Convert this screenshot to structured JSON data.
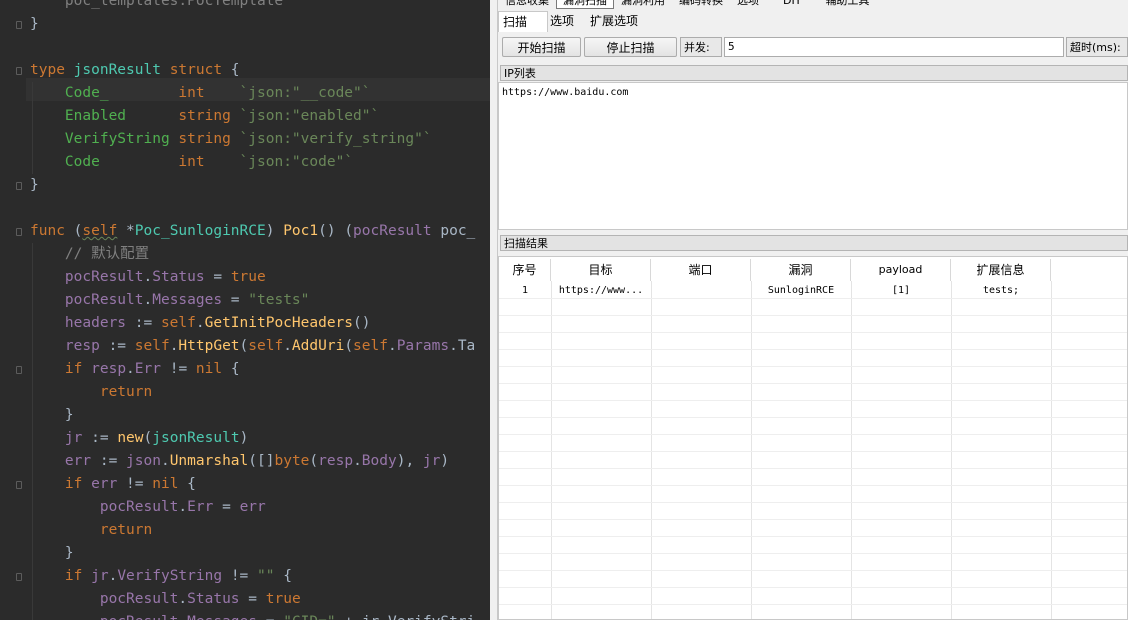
{
  "editor": {
    "lines": [
      [
        [
          "    ",
          ""
        ],
        [
          "poc_templates.PocTemplate",
          "cmt"
        ]
      ],
      [
        [
          "}",
          ""
        ]
      ],
      [
        [
          "",
          ""
        ]
      ],
      [
        [
          "type ",
          "kw"
        ],
        [
          "jsonResult ",
          "type"
        ],
        [
          "struct ",
          "kw"
        ],
        [
          "{",
          ""
        ]
      ],
      [
        [
          "    ",
          ""
        ],
        [
          "Code_",
          "gfld"
        ],
        [
          "        ",
          ""
        ],
        [
          "int",
          "kw"
        ],
        [
          "    ",
          ""
        ],
        [
          "`json:\"__code\"`",
          "tag"
        ]
      ],
      [
        [
          "    ",
          ""
        ],
        [
          "Enabled",
          "gfld"
        ],
        [
          "      ",
          ""
        ],
        [
          "string",
          "kw"
        ],
        [
          " ",
          ""
        ],
        [
          "`json:\"enabled\"`",
          "tag"
        ]
      ],
      [
        [
          "    ",
          ""
        ],
        [
          "VerifyString",
          "gfld"
        ],
        [
          " ",
          ""
        ],
        [
          "string",
          "kw"
        ],
        [
          " ",
          ""
        ],
        [
          "`json:\"verify_string\"`",
          "tag"
        ]
      ],
      [
        [
          "    ",
          ""
        ],
        [
          "Code",
          "gfld"
        ],
        [
          "         ",
          ""
        ],
        [
          "int",
          "kw"
        ],
        [
          "    ",
          ""
        ],
        [
          "`json:\"code\"`",
          "tag"
        ]
      ],
      [
        [
          "}",
          ""
        ]
      ],
      [
        [
          "",
          ""
        ]
      ],
      [
        [
          "func ",
          "kw"
        ],
        [
          "(",
          ""
        ],
        [
          "self",
          "self"
        ],
        [
          " *",
          ""
        ],
        [
          "Poc_SunloginRCE",
          "type"
        ],
        [
          ") ",
          ""
        ],
        [
          "Poc1",
          "fn"
        ],
        [
          "() (",
          ""
        ],
        [
          "pocResult",
          "fld"
        ],
        [
          " poc_",
          ""
        ]
      ],
      [
        [
          "    ",
          ""
        ],
        [
          "// 默认配置",
          "cmt"
        ]
      ],
      [
        [
          "    ",
          ""
        ],
        [
          "pocResult",
          "fld"
        ],
        [
          ".",
          ""
        ],
        [
          "Status",
          "fld"
        ],
        [
          " = ",
          ""
        ],
        [
          "true",
          "kw"
        ]
      ],
      [
        [
          "    ",
          ""
        ],
        [
          "pocResult",
          "fld"
        ],
        [
          ".",
          ""
        ],
        [
          "Messages",
          "fld"
        ],
        [
          " = ",
          ""
        ],
        [
          "\"tests\"",
          "str"
        ]
      ],
      [
        [
          "    ",
          ""
        ],
        [
          "headers",
          "fld"
        ],
        [
          " := ",
          ""
        ],
        [
          "self",
          "kw"
        ],
        [
          ".",
          ""
        ],
        [
          "GetInitPocHeaders",
          "fn"
        ],
        [
          "()",
          ""
        ]
      ],
      [
        [
          "    ",
          ""
        ],
        [
          "resp",
          "fld"
        ],
        [
          " := ",
          ""
        ],
        [
          "self",
          "kw"
        ],
        [
          ".",
          ""
        ],
        [
          "HttpGet",
          "fn"
        ],
        [
          "(",
          ""
        ],
        [
          "self",
          "kw"
        ],
        [
          ".",
          ""
        ],
        [
          "AddUri",
          "fn"
        ],
        [
          "(",
          ""
        ],
        [
          "self",
          "kw"
        ],
        [
          ".",
          ""
        ],
        [
          "Params",
          "fld"
        ],
        [
          ".Ta",
          ""
        ]
      ],
      [
        [
          "    ",
          ""
        ],
        [
          "if ",
          "kw"
        ],
        [
          "resp",
          "fld"
        ],
        [
          ".",
          ""
        ],
        [
          "Err",
          "fld"
        ],
        [
          " != ",
          ""
        ],
        [
          "nil",
          "kw"
        ],
        [
          " {",
          ""
        ]
      ],
      [
        [
          "        ",
          ""
        ],
        [
          "return",
          "kw"
        ]
      ],
      [
        [
          "    ",
          ""
        ],
        [
          "}",
          ""
        ]
      ],
      [
        [
          "    ",
          ""
        ],
        [
          "jr",
          "fld"
        ],
        [
          " := ",
          ""
        ],
        [
          "new",
          "fn"
        ],
        [
          "(",
          ""
        ],
        [
          "jsonResult",
          "type"
        ],
        [
          ")",
          ""
        ]
      ],
      [
        [
          "    ",
          ""
        ],
        [
          "err",
          "fld"
        ],
        [
          " := ",
          ""
        ],
        [
          "json",
          "fld"
        ],
        [
          ".",
          ""
        ],
        [
          "Unmarshal",
          "fn"
        ],
        [
          "([]",
          ""
        ],
        [
          "byte",
          "kw"
        ],
        [
          "(",
          ""
        ],
        [
          "resp",
          "fld"
        ],
        [
          ".",
          ""
        ],
        [
          "Body",
          "fld"
        ],
        [
          "), ",
          ""
        ],
        [
          "jr",
          "fld"
        ],
        [
          ")",
          ""
        ]
      ],
      [
        [
          "    ",
          ""
        ],
        [
          "if ",
          "kw"
        ],
        [
          "err",
          "fld"
        ],
        [
          " != ",
          ""
        ],
        [
          "nil",
          "kw"
        ],
        [
          " {",
          ""
        ]
      ],
      [
        [
          "        ",
          ""
        ],
        [
          "pocResult",
          "fld"
        ],
        [
          ".",
          ""
        ],
        [
          "Err",
          "fld"
        ],
        [
          " = ",
          ""
        ],
        [
          "err",
          "fld"
        ]
      ],
      [
        [
          "        ",
          ""
        ],
        [
          "return",
          "kw"
        ]
      ],
      [
        [
          "    ",
          ""
        ],
        [
          "}",
          ""
        ]
      ],
      [
        [
          "    ",
          ""
        ],
        [
          "if ",
          "kw"
        ],
        [
          "jr",
          "fld"
        ],
        [
          ".",
          ""
        ],
        [
          "VerifyString",
          "fld"
        ],
        [
          " != ",
          ""
        ],
        [
          "\"\"",
          "str"
        ],
        [
          " {",
          ""
        ]
      ],
      [
        [
          "        ",
          ""
        ],
        [
          "pocResult",
          "fld"
        ],
        [
          ".",
          ""
        ],
        [
          "Status",
          "fld"
        ],
        [
          " = ",
          ""
        ],
        [
          "true",
          "kw"
        ]
      ],
      [
        [
          "        ",
          ""
        ],
        [
          "pocResult",
          "fld"
        ],
        [
          ".",
          ""
        ],
        [
          "Messages",
          "fld"
        ],
        [
          " = ",
          ""
        ],
        [
          "\"CID=\"",
          "str"
        ],
        [
          " + jr.VerifyStri",
          ""
        ]
      ]
    ]
  },
  "app": {
    "top_tabs": [
      "信息收集",
      "漏洞扫描",
      "漏洞利用",
      "编码转换",
      "选项",
      "DIY",
      "辅助工具"
    ],
    "sub_tabs": [
      "扫描",
      "选项",
      "扩展选项"
    ],
    "toolbar": {
      "start_label": "开始扫描",
      "stop_label": "停止扫描",
      "concurrency_label": "并发:",
      "concurrency_value": "5",
      "timeout_label": "超时(ms):"
    },
    "ip_list": {
      "title": "IP列表",
      "content": "https://www.baidu.com"
    },
    "results": {
      "title": "扫描结果",
      "columns": [
        "序号",
        "目标",
        "端口",
        "漏洞",
        "payload",
        "扩展信息"
      ],
      "rows": [
        [
          "1",
          "https://www...",
          "",
          "SunloginRCE",
          "[1]",
          "tests;"
        ]
      ]
    }
  }
}
